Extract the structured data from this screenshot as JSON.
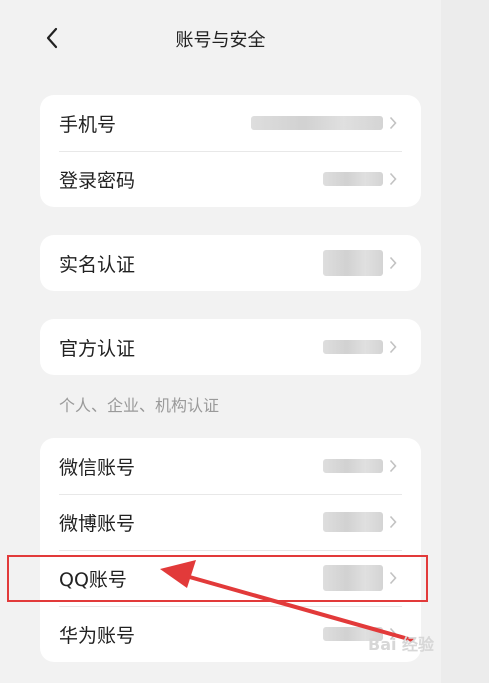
{
  "header": {
    "title": "账号与安全"
  },
  "cards": [
    {
      "rows": [
        {
          "label": "手机号"
        },
        {
          "label": "登录密码"
        }
      ]
    },
    {
      "rows": [
        {
          "label": "实名认证"
        }
      ]
    },
    {
      "rows": [
        {
          "label": "官方认证"
        }
      ]
    },
    {
      "rows": [
        {
          "label": "微信账号"
        },
        {
          "label": "微博账号"
        },
        {
          "label": "QQ账号"
        },
        {
          "label": "华为账号"
        }
      ]
    }
  ],
  "section_note": "个人、企业、机构认证",
  "watermark": "Bai 经验",
  "colors": {
    "highlight": "#e23a3a",
    "background": "#f2f2f2",
    "card": "#ffffff"
  },
  "icons": {
    "back": "chevron-left-icon",
    "row_arrow": "chevron-right-icon"
  }
}
